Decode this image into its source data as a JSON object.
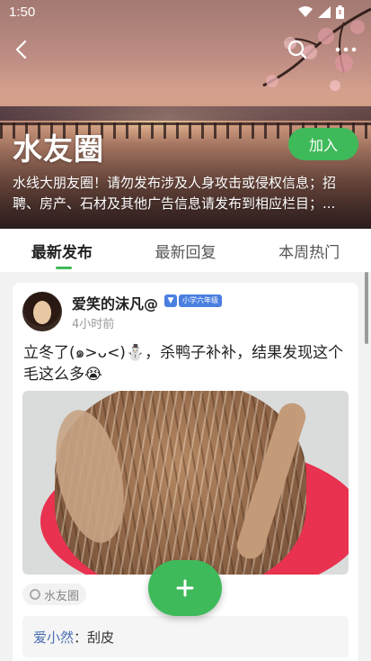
{
  "status_bar": {
    "time": "1:50",
    "icons": [
      "wifi-icon",
      "signal-icon",
      "battery-icon"
    ]
  },
  "header": {
    "back_icon": "chevron-left-icon",
    "search_icon": "search-icon",
    "more_icon": "more-icon"
  },
  "group": {
    "title": "水友圈",
    "join_label": "加入",
    "description": "水线大朋友圈！请勿发布涉及人身攻击或侵权信息；招聘、房产、石材及其他广告信息请发布到相应栏目；..."
  },
  "tabs": [
    {
      "label": "最新发布",
      "active": true
    },
    {
      "label": "最新回复",
      "active": false
    },
    {
      "label": "本周热门",
      "active": false
    }
  ],
  "post": {
    "author": "爱笑的沫凡@",
    "badge": "小学六年级",
    "time": "4小时前",
    "text": "立冬了(๑>ᴗ<)⛄，杀鸭子补补，结果发现这个毛这么多😭",
    "tag": "水友圈",
    "comment": {
      "user": "爱小然",
      "separator": "：",
      "text": "刮皮"
    }
  },
  "colors": {
    "accent": "#3fba5a",
    "badge": "#4a7fe0",
    "comment_user": "#4a6fb3"
  }
}
